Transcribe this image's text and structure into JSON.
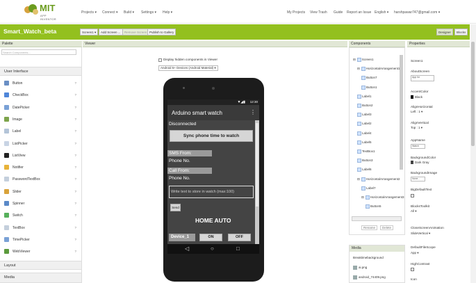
{
  "logo": {
    "brand": "MIT",
    "sub": "APP INVENTOR"
  },
  "top_menu": {
    "projects": "Projects ▾",
    "connect": "Connect ▾",
    "build": "Build ▾",
    "settings": "Settings ▾",
    "help": "Help ▾"
  },
  "top_right": {
    "my_projects": "My Projects",
    "view_trash": "View Trash",
    "guide": "Guide",
    "report": "Report an Issue",
    "language": "English ▾",
    "email": "harshpawar747@gmail.com ▾"
  },
  "project": {
    "name": "Smart_Watch_beta",
    "screen_dropdown": "Screen1 ▾",
    "add_screen": "Add Screen ...",
    "remove_screen": "Remove Screen",
    "publish": "Publish to Gallery",
    "designer": "Designer",
    "blocks": "Blocks"
  },
  "columns": {
    "palette": "Palette",
    "viewer": "Viewer",
    "components": "Components",
    "properties": "Properties"
  },
  "palette": {
    "search_placeholder": "Search Components...",
    "section": "User Interface",
    "items": [
      {
        "label": "Button",
        "icon": "button-icon",
        "color": "#6a8fc4"
      },
      {
        "label": "CheckBox",
        "icon": "checkbox-icon",
        "color": "#4f86d9"
      },
      {
        "label": "DatePicker",
        "icon": "datepicker-icon",
        "color": "#7aa1d6"
      },
      {
        "label": "Image",
        "icon": "image-icon",
        "color": "#7da44b"
      },
      {
        "label": "Label",
        "icon": "label-icon",
        "color": "#b3c4d8"
      },
      {
        "label": "ListPicker",
        "icon": "listpicker-icon",
        "color": "#c8d4e4"
      },
      {
        "label": "ListView",
        "icon": "listview-icon",
        "color": "#222222"
      },
      {
        "label": "Notifier",
        "icon": "notifier-icon",
        "color": "#e8b33a"
      },
      {
        "label": "PasswordTextBox",
        "icon": "password-icon",
        "color": "#c4cfdc"
      },
      {
        "label": "Slider",
        "icon": "slider-icon",
        "color": "#d8a23a"
      },
      {
        "label": "Spinner",
        "icon": "spinner-icon",
        "color": "#5a89c7"
      },
      {
        "label": "Switch",
        "icon": "switch-icon",
        "color": "#57b05c"
      },
      {
        "label": "TextBox",
        "icon": "textbox-icon",
        "color": "#c4cfdc"
      },
      {
        "label": "TimePicker",
        "icon": "timepicker-icon",
        "color": "#7aa1d6"
      },
      {
        "label": "WebViewer",
        "icon": "webviewer-icon",
        "color": "#5b9a3c"
      }
    ],
    "help_mark": "?",
    "section_layout": "Layout",
    "section_media": "Media"
  },
  "viewer": {
    "checkbox_label": "Display hidden components in Viewer",
    "device_select": "Android 5+ Devices (Android Material) ▾"
  },
  "phone": {
    "status_time": "12:30",
    "app_title": "Arduino smart watch",
    "menu_dots": "⋮",
    "disconnected": "Disconnected",
    "sync_button": "Sync phone time to watch",
    "sms_from": "SMS From:",
    "phone_no_1": "Phone No.",
    "call_from": "Call From:",
    "phone_no_2": "Phone No.",
    "text_placeholder": "Write text to store in watch (max:100)",
    "send_button": "Send",
    "home_auto": "HOME AUTO",
    "device_label": "Device_1",
    "on_button": "ON",
    "off_button": "OFF",
    "nav_back": "◁",
    "nav_home": "○",
    "nav_recent": "□"
  },
  "components": {
    "tree": [
      {
        "label": "Screen1",
        "indent": 0,
        "toggle": "⊟"
      },
      {
        "label": "HorizontalArrangement1",
        "indent": 1,
        "toggle": "⊟"
      },
      {
        "label": "Button7",
        "indent": 2,
        "toggle": ""
      },
      {
        "label": "Button1",
        "indent": 2,
        "toggle": ""
      },
      {
        "label": "Label1",
        "indent": 1,
        "toggle": ""
      },
      {
        "label": "Button2",
        "indent": 1,
        "toggle": ""
      },
      {
        "label": "Label3",
        "indent": 1,
        "toggle": ""
      },
      {
        "label": "Label2",
        "indent": 1,
        "toggle": ""
      },
      {
        "label": "Label4",
        "indent": 1,
        "toggle": ""
      },
      {
        "label": "Label5",
        "indent": 1,
        "toggle": ""
      },
      {
        "label": "TextBox1",
        "indent": 1,
        "toggle": ""
      },
      {
        "label": "Button3",
        "indent": 1,
        "toggle": ""
      },
      {
        "label": "Label6",
        "indent": 1,
        "toggle": ""
      },
      {
        "label": "HorizontalArrangement2",
        "indent": 1,
        "toggle": "⊟"
      },
      {
        "label": "Label7",
        "indent": 2,
        "toggle": ""
      },
      {
        "label": "HorizontalArrangement3",
        "indent": 2,
        "toggle": "⊟"
      },
      {
        "label": "Button5",
        "indent": 3,
        "toggle": ""
      }
    ],
    "rename": "Rename",
    "delete": "Delete"
  },
  "media": {
    "title": "Media",
    "files": [
      "Breaktimebackground",
      "ai.png",
      "android_74409.png"
    ]
  },
  "properties": {
    "screen": "Screen1",
    "about_label": "AboutScreen",
    "about_value": "App for",
    "accent_label": "AccentColor",
    "accent_value": "Black",
    "align_h_label": "AlignHorizontal",
    "align_h_value": "Left : 1 ▾",
    "align_v_label": "AlignVertical",
    "align_v_value": "Top : 1 ▾",
    "appname_label": "AppName",
    "appname_value": "Watch",
    "bgcolor_label": "BackgroundColor",
    "bgcolor_value": "Dark Gray",
    "bgimage_label": "BackgroundImage",
    "bgimage_value": "None...",
    "bigtext_label": "BigDefaultText",
    "blockstoolkit_label": "BlocksToolkit",
    "blockstoolkit_value": "All ▾",
    "closeanim_label": "CloseScreenAnimation",
    "closeanim_value": "SlideVertical ▾",
    "filescope_label": "DefaultFileScope",
    "filescope_value": "App ▾",
    "highcontrast_label": "HighContrast",
    "icon_label": "Icon",
    "colors": {
      "black": "#000000",
      "darkgray": "#444444"
    }
  }
}
